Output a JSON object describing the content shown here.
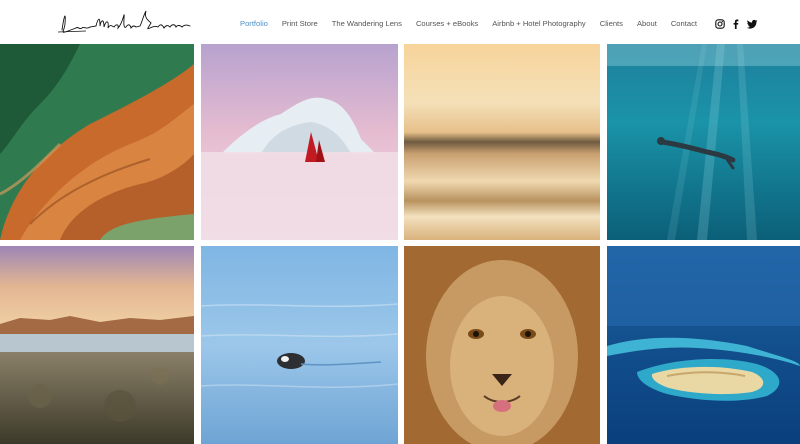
{
  "header": {
    "logo_text": "Lisa Michele Burns"
  },
  "nav": {
    "items": [
      {
        "label": "Portfolio",
        "active": true
      },
      {
        "label": "Print Store",
        "active": false
      },
      {
        "label": "The Wandering Lens",
        "active": false
      },
      {
        "label": "Courses + eBooks",
        "active": false
      },
      {
        "label": "Airbnb + Hotel Photography",
        "active": false
      },
      {
        "label": "Clients",
        "active": false
      },
      {
        "label": "About",
        "active": false
      },
      {
        "label": "Contact",
        "active": false
      }
    ],
    "active_color": "#4a90c8",
    "text_color": "#555555"
  },
  "social": [
    {
      "icon": "instagram-icon"
    },
    {
      "icon": "facebook-icon"
    },
    {
      "icon": "twitter-icon"
    }
  ],
  "gallery": {
    "tiles": [
      {
        "icon": "aerial-river-delta-image"
      },
      {
        "icon": "iceberg-red-sail-image"
      },
      {
        "icon": "ocean-motion-blur-image"
      },
      {
        "icon": "underwater-swimmer-image"
      },
      {
        "icon": "split-level-lake-image"
      },
      {
        "icon": "seal-in-water-image"
      },
      {
        "icon": "lion-portrait-image"
      },
      {
        "icon": "coral-reef-aerial-image"
      }
    ]
  }
}
